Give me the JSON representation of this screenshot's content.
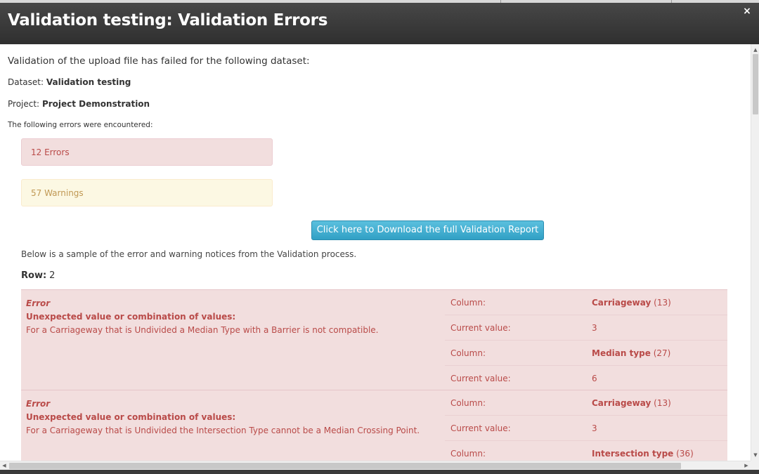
{
  "modal": {
    "title": "Validation testing: Validation Errors",
    "close_icon": "close-icon",
    "close_glyph": "×"
  },
  "body": {
    "lead": "Validation of the upload file has failed for the following dataset:",
    "dataset_label": "Dataset:",
    "dataset_value": "Validation testing",
    "project_label": "Project:",
    "project_value": "Project Demonstration",
    "errors_intro": "The following errors were encountered:",
    "error_count": "12 Errors",
    "warning_count": "57 Warnings",
    "download_label": "Click here to Download the full Validation Report",
    "sample_text": "Below is a sample of the error and warning notices from the Validation process.",
    "row_label": "Row:",
    "row_number": "2"
  },
  "notices": [
    {
      "type": "Error",
      "heading": "Unexpected value or combination of values:",
      "message": "For a Carriageway that is Undivided a Median Type with a Barrier is not compatible.",
      "cells": [
        {
          "key": "Column:",
          "value": "Carriageway",
          "suffix": " (13)"
        },
        {
          "key": "Current value:",
          "value": "3",
          "suffix": ""
        },
        {
          "key": "Column:",
          "value": "Median type",
          "suffix": " (27)"
        },
        {
          "key": "Current value:",
          "value": "6",
          "suffix": ""
        }
      ]
    },
    {
      "type": "Error",
      "heading": "Unexpected value or combination of values:",
      "message": "For a Carriageway that is Undivided the Intersection Type cannot be a Median Crossing Point.",
      "cells": [
        {
          "key": "Column:",
          "value": "Carriageway",
          "suffix": " (13)"
        },
        {
          "key": "Current value:",
          "value": "3",
          "suffix": ""
        },
        {
          "key": "Column:",
          "value": "Intersection type",
          "suffix": " (36)"
        },
        {
          "key": "Current value:",
          "value": "",
          "suffix": ""
        }
      ]
    }
  ],
  "colors": {
    "error_bg": "#f2dede",
    "error_text": "#b94a48",
    "warning_bg": "#fcf8e3",
    "warning_text": "#c09853",
    "button_bg": "#5bc0de"
  },
  "scrollbar": {
    "up_glyph": "▲",
    "down_glyph": "▼",
    "left_glyph": "◀",
    "right_glyph": "▶"
  }
}
